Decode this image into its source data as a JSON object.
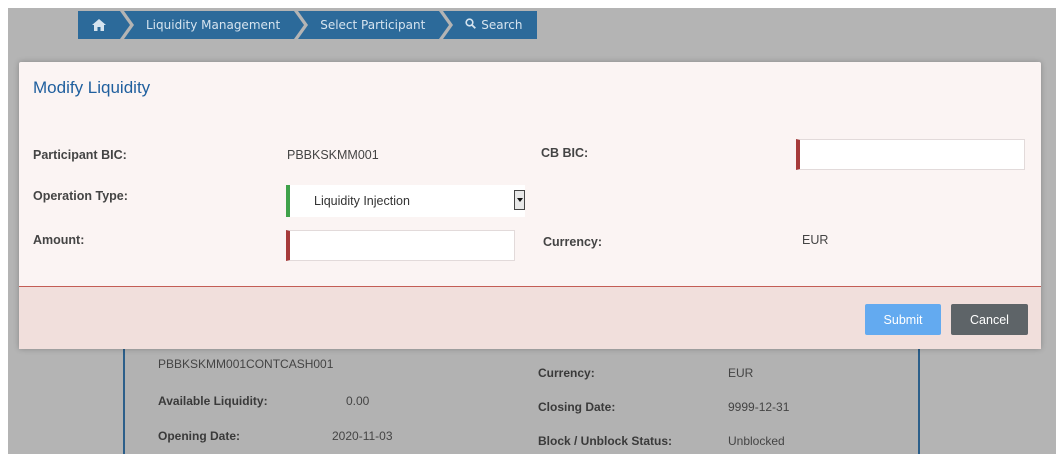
{
  "breadcrumb": {
    "home_icon": "home-icon",
    "items": [
      "Liquidity Management",
      "Select Participant"
    ],
    "search_label": "Search",
    "search_icon": "search-icon"
  },
  "background_panel": {
    "account": "PBBKSKMM001CONTCASH001",
    "available_liquidity_label": "Available Liquidity:",
    "available_liquidity_value": "0.00",
    "opening_date_label": "Opening Date:",
    "opening_date_value": "2020-11-03",
    "currency_label": "Currency:",
    "currency_value": "EUR",
    "closing_date_label": "Closing Date:",
    "closing_date_value": "9999-12-31",
    "block_status_label": "Block / Unblock Status:",
    "block_status_value": "Unblocked"
  },
  "modal": {
    "title": "Modify Liquidity",
    "participant_bic_label": "Participant BIC:",
    "participant_bic_value": "PBBKSKMM001",
    "cb_bic_label": "CB BIC:",
    "cb_bic_value": "",
    "operation_type_label": "Operation Type:",
    "operation_type_value": "Liquidity Injection",
    "amount_label": "Amount:",
    "amount_value": "",
    "currency_label": "Currency:",
    "currency_value": "EUR",
    "submit_label": "Submit",
    "cancel_label": "Cancel"
  },
  "colors": {
    "accent_blue": "#1f5f9e",
    "submit_blue": "#63aaf0",
    "required_red": "#a63a3a",
    "valid_green": "#3fa14a",
    "cancel_grey": "#5e6468"
  }
}
